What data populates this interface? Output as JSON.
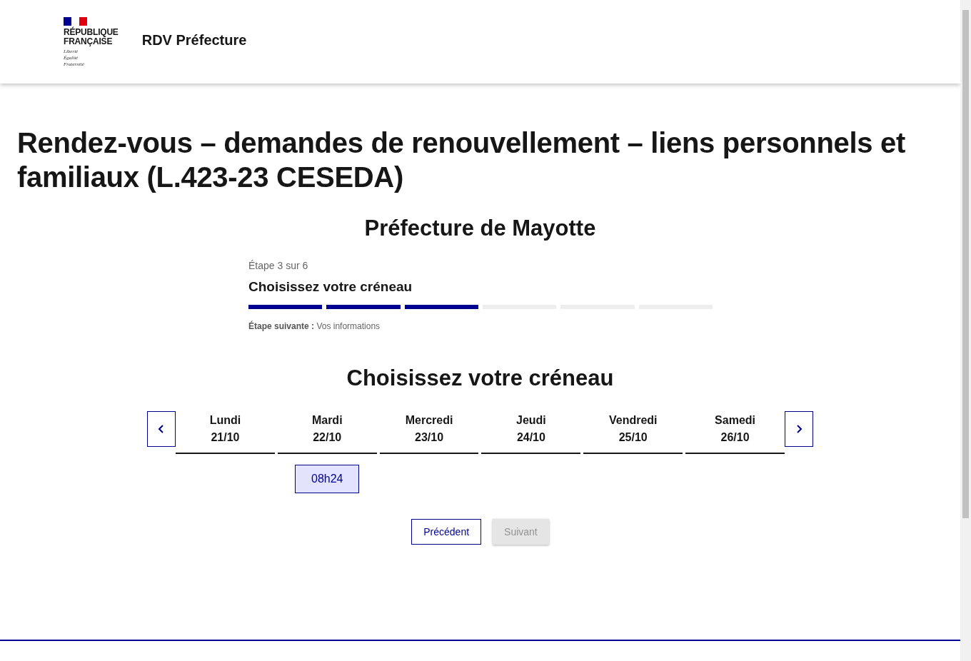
{
  "header": {
    "logo_lines": [
      "RÉPUBLIQUE",
      "FRANÇAISE"
    ],
    "motto": [
      "Liberté",
      "Égalité",
      "Fraternité"
    ],
    "service_name": "RDV Préfecture"
  },
  "page_title": "Rendez-vous – demandes de renouvellement – liens personnels et familiaux (L.423-23 CESEDA)",
  "subtitle": "Préfecture de Mayotte",
  "stepper": {
    "step_label": "Étape 3 sur 6",
    "step_title": "Choisissez votre créneau",
    "segments": [
      {
        "completed": true
      },
      {
        "completed": true
      },
      {
        "completed": true
      },
      {
        "completed": false
      },
      {
        "completed": false
      },
      {
        "completed": false
      }
    ],
    "next_label": "Étape suivante :",
    "next_value": "Vos informations"
  },
  "slots_title": "Choisissez votre créneau",
  "days": [
    {
      "day": "Lundi",
      "date": "21/10"
    },
    {
      "day": "Mardi",
      "date": "22/10",
      "slots": [
        "08h24"
      ]
    },
    {
      "day": "Mercredi",
      "date": "23/10"
    },
    {
      "day": "Jeudi",
      "date": "24/10"
    },
    {
      "day": "Vendredi",
      "date": "25/10"
    },
    {
      "day": "Samedi",
      "date": "26/10"
    }
  ],
  "buttons": [
    {
      "label": "Précédent",
      "disabled": false
    },
    {
      "label": "Suivant",
      "disabled": true
    }
  ]
}
